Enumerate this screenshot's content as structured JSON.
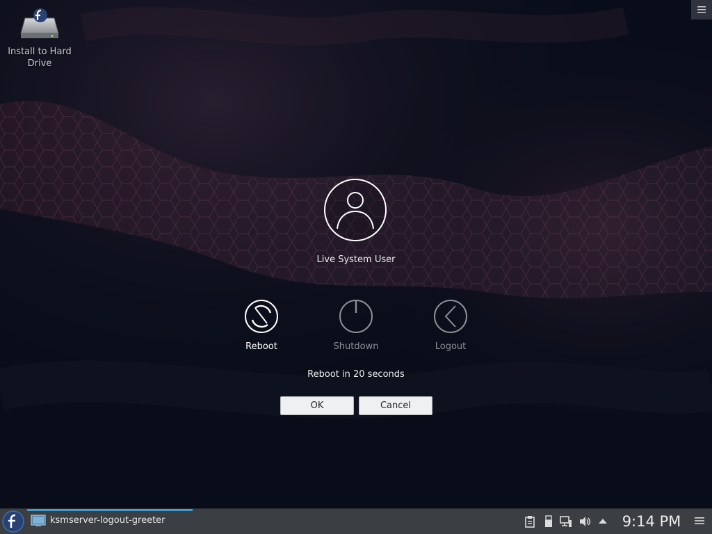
{
  "desktop": {
    "icons": [
      {
        "label": "Install to Hard Drive",
        "icon": "install-drive-icon"
      }
    ],
    "toolbox_icon": "hamburger-menu-icon"
  },
  "greeter": {
    "user_name": "Live System User",
    "avatar_icon": "user-avatar-icon",
    "actions": [
      {
        "label": "Reboot",
        "icon": "reboot-icon",
        "selected": true
      },
      {
        "label": "Shutdown",
        "icon": "power-icon",
        "selected": false
      },
      {
        "label": "Logout",
        "icon": "logout-chevron-icon",
        "selected": false
      }
    ],
    "countdown_text": "Reboot in 20 seconds",
    "ok_label": "OK",
    "cancel_label": "Cancel"
  },
  "panel": {
    "launcher_icon": "fedora-logo-icon",
    "task": {
      "label": "ksmserver-logout-greeter",
      "icon": "window-icon"
    },
    "tray_icons": [
      "clipboard-icon",
      "usb-device-icon",
      "network-icon",
      "volume-icon",
      "expand-tray-icon"
    ],
    "clock": "9:14 PM",
    "menu_icon": "panel-menu-icon"
  },
  "colors": {
    "panel_bg": "#3b3e42",
    "accent": "#3daee9",
    "background": "#0b0f1c"
  }
}
